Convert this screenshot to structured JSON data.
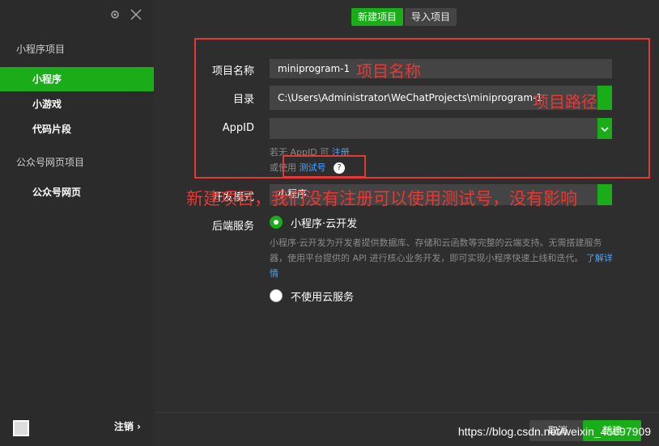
{
  "sidebar": {
    "sections": [
      {
        "title": "小程序项目",
        "items": [
          "小程序",
          "小游戏",
          "代码片段"
        ]
      },
      {
        "title": "公众号网页项目",
        "items": [
          "公众号网页"
        ]
      }
    ],
    "active_item": "小程序",
    "logout_label": "注销 ›"
  },
  "tabs": {
    "new_project": "新建项目",
    "import_project": "导入项目"
  },
  "form": {
    "project_name_label": "项目名称",
    "project_name_value": "miniprogram-1",
    "dir_label": "目录",
    "dir_value": "C:\\Users\\Administrator\\WeChatProjects\\miniprogram-1",
    "appid_label": "AppID",
    "appid_value": "",
    "hint_line1_prefix": "若无 AppID 可",
    "hint_line1_link": "注册",
    "hint_line2_prefix": "或使用",
    "hint_line2_link": "测试号",
    "devmode_label": "开发模式",
    "devmode_value": "小程序",
    "backend_label": "后端服务",
    "backend_option1": "小程序·云开发",
    "backend_desc": "小程序·云开发为开发者提供数据库、存储和云函数等完整的云端支持。无需搭建服务器，使用平台提供的 API 进行核心业务开发，即可实现小程序快速上线和迭代。",
    "backend_desc_link": "了解详情",
    "backend_option2": "不使用云服务"
  },
  "annotations": {
    "name_note": "项目名称",
    "path_note": "项目路径",
    "testno_note": "新建项目，我们没有注册可以使用测试号，没有影响"
  },
  "buttons": {
    "cancel": "取消",
    "create": "新建"
  },
  "watermark": "https://blog.csdn.net/weixin_45697909",
  "colors": {
    "accent": "#1aad19",
    "annotation": "#e53935"
  }
}
